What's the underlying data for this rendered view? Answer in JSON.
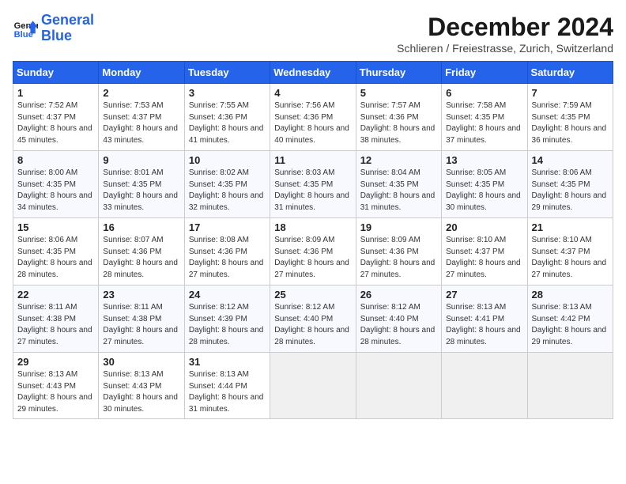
{
  "header": {
    "logo_line1": "General",
    "logo_line2": "Blue",
    "month_title": "December 2024",
    "subtitle": "Schlieren / Freiestrasse, Zurich, Switzerland"
  },
  "days_of_week": [
    "Sunday",
    "Monday",
    "Tuesday",
    "Wednesday",
    "Thursday",
    "Friday",
    "Saturday"
  ],
  "weeks": [
    [
      {
        "day": "1",
        "sunrise": "7:52 AM",
        "sunset": "4:37 PM",
        "daylight": "8 hours and 45 minutes."
      },
      {
        "day": "2",
        "sunrise": "7:53 AM",
        "sunset": "4:37 PM",
        "daylight": "8 hours and 43 minutes."
      },
      {
        "day": "3",
        "sunrise": "7:55 AM",
        "sunset": "4:36 PM",
        "daylight": "8 hours and 41 minutes."
      },
      {
        "day": "4",
        "sunrise": "7:56 AM",
        "sunset": "4:36 PM",
        "daylight": "8 hours and 40 minutes."
      },
      {
        "day": "5",
        "sunrise": "7:57 AM",
        "sunset": "4:36 PM",
        "daylight": "8 hours and 38 minutes."
      },
      {
        "day": "6",
        "sunrise": "7:58 AM",
        "sunset": "4:35 PM",
        "daylight": "8 hours and 37 minutes."
      },
      {
        "day": "7",
        "sunrise": "7:59 AM",
        "sunset": "4:35 PM",
        "daylight": "8 hours and 36 minutes."
      }
    ],
    [
      {
        "day": "8",
        "sunrise": "8:00 AM",
        "sunset": "4:35 PM",
        "daylight": "8 hours and 34 minutes."
      },
      {
        "day": "9",
        "sunrise": "8:01 AM",
        "sunset": "4:35 PM",
        "daylight": "8 hours and 33 minutes."
      },
      {
        "day": "10",
        "sunrise": "8:02 AM",
        "sunset": "4:35 PM",
        "daylight": "8 hours and 32 minutes."
      },
      {
        "day": "11",
        "sunrise": "8:03 AM",
        "sunset": "4:35 PM",
        "daylight": "8 hours and 31 minutes."
      },
      {
        "day": "12",
        "sunrise": "8:04 AM",
        "sunset": "4:35 PM",
        "daylight": "8 hours and 31 minutes."
      },
      {
        "day": "13",
        "sunrise": "8:05 AM",
        "sunset": "4:35 PM",
        "daylight": "8 hours and 30 minutes."
      },
      {
        "day": "14",
        "sunrise": "8:06 AM",
        "sunset": "4:35 PM",
        "daylight": "8 hours and 29 minutes."
      }
    ],
    [
      {
        "day": "15",
        "sunrise": "8:06 AM",
        "sunset": "4:35 PM",
        "daylight": "8 hours and 28 minutes."
      },
      {
        "day": "16",
        "sunrise": "8:07 AM",
        "sunset": "4:36 PM",
        "daylight": "8 hours and 28 minutes."
      },
      {
        "day": "17",
        "sunrise": "8:08 AM",
        "sunset": "4:36 PM",
        "daylight": "8 hours and 27 minutes."
      },
      {
        "day": "18",
        "sunrise": "8:09 AM",
        "sunset": "4:36 PM",
        "daylight": "8 hours and 27 minutes."
      },
      {
        "day": "19",
        "sunrise": "8:09 AM",
        "sunset": "4:36 PM",
        "daylight": "8 hours and 27 minutes."
      },
      {
        "day": "20",
        "sunrise": "8:10 AM",
        "sunset": "4:37 PM",
        "daylight": "8 hours and 27 minutes."
      },
      {
        "day": "21",
        "sunrise": "8:10 AM",
        "sunset": "4:37 PM",
        "daylight": "8 hours and 27 minutes."
      }
    ],
    [
      {
        "day": "22",
        "sunrise": "8:11 AM",
        "sunset": "4:38 PM",
        "daylight": "8 hours and 27 minutes."
      },
      {
        "day": "23",
        "sunrise": "8:11 AM",
        "sunset": "4:38 PM",
        "daylight": "8 hours and 27 minutes."
      },
      {
        "day": "24",
        "sunrise": "8:12 AM",
        "sunset": "4:39 PM",
        "daylight": "8 hours and 28 minutes."
      },
      {
        "day": "25",
        "sunrise": "8:12 AM",
        "sunset": "4:40 PM",
        "daylight": "8 hours and 28 minutes."
      },
      {
        "day": "26",
        "sunrise": "8:12 AM",
        "sunset": "4:40 PM",
        "daylight": "8 hours and 28 minutes."
      },
      {
        "day": "27",
        "sunrise": "8:13 AM",
        "sunset": "4:41 PM",
        "daylight": "8 hours and 28 minutes."
      },
      {
        "day": "28",
        "sunrise": "8:13 AM",
        "sunset": "4:42 PM",
        "daylight": "8 hours and 29 minutes."
      }
    ],
    [
      {
        "day": "29",
        "sunrise": "8:13 AM",
        "sunset": "4:43 PM",
        "daylight": "8 hours and 29 minutes."
      },
      {
        "day": "30",
        "sunrise": "8:13 AM",
        "sunset": "4:43 PM",
        "daylight": "8 hours and 30 minutes."
      },
      {
        "day": "31",
        "sunrise": "8:13 AM",
        "sunset": "4:44 PM",
        "daylight": "8 hours and 31 minutes."
      },
      null,
      null,
      null,
      null
    ]
  ]
}
